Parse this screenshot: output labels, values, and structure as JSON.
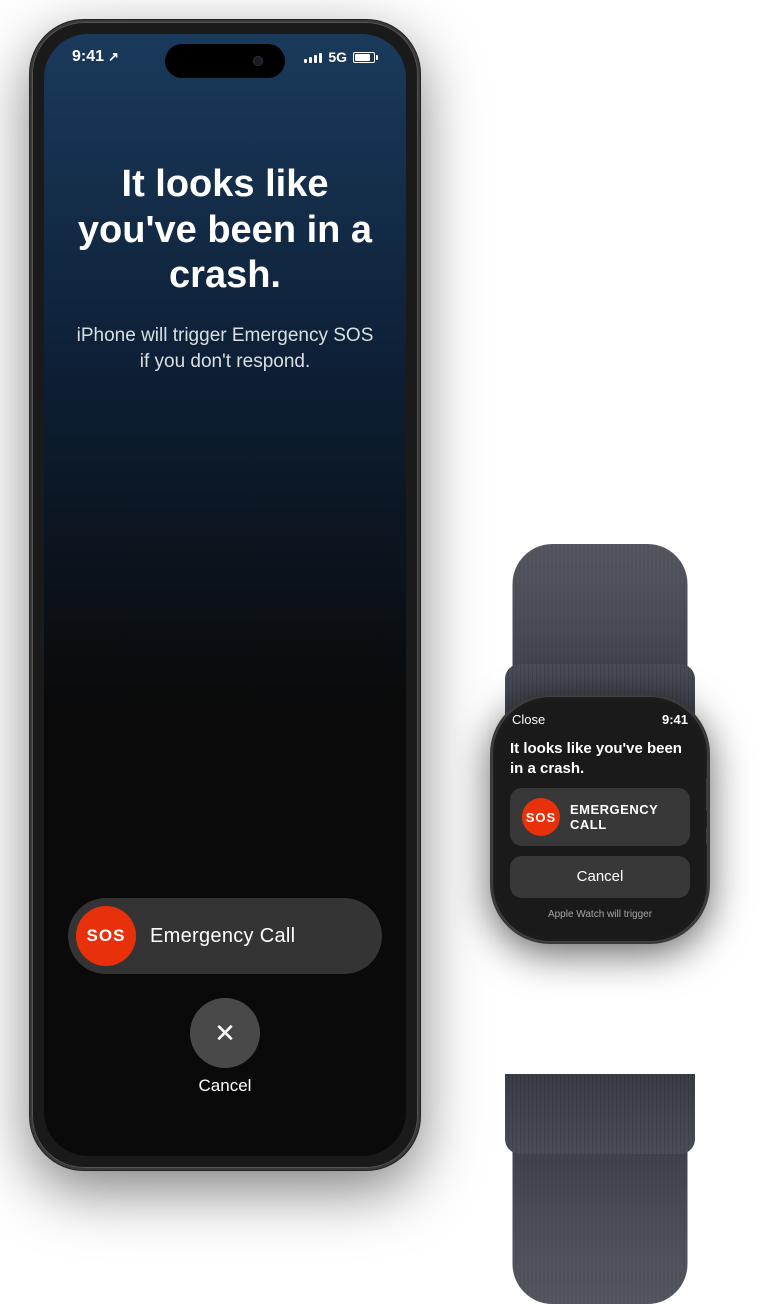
{
  "iphone": {
    "status_bar": {
      "time": "9:41",
      "signal": "5G",
      "battery": "full"
    },
    "screen": {
      "title": "It looks like you've been in a crash.",
      "subtitle": "iPhone will trigger Emergency SOS if you don't respond.",
      "sos_button_label": "SOS",
      "emergency_call_label": "Emergency Call",
      "cancel_label": "Cancel"
    }
  },
  "watch": {
    "status_bar": {
      "close_label": "Close",
      "time": "9:41"
    },
    "screen": {
      "title": "It looks like you've been in a crash.",
      "sos_label": "SOS",
      "emergency_call_label": "EMERGENCY\nCALL",
      "cancel_label": "Cancel",
      "trigger_text": "Apple Watch will trigger"
    }
  }
}
